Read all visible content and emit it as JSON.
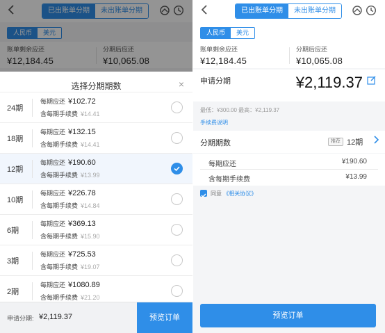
{
  "colors": {
    "accent": "#2f8ee8",
    "overlay": "rgba(0,0,0,0.42)",
    "muted": "#aaaaaa"
  },
  "tabs": [
    {
      "label": "已出账单分期",
      "active": true
    },
    {
      "label": "未出账单分期",
      "active": false
    }
  ],
  "header_icons": [
    "refresh-icon",
    "clock-icon"
  ],
  "currency": [
    {
      "label": "人民币",
      "active": true
    },
    {
      "label": "美元",
      "active": false
    }
  ],
  "balance": {
    "remaining_label": "账单剩余应还",
    "remaining_value": "¥12,184.45",
    "after_label": "分期后应还",
    "after_value": "¥10,065.08"
  },
  "sheet": {
    "title": "选择分期期数",
    "close_symbol": "×",
    "per_period_label": "每期应还",
    "fee_label": "含每期手续费",
    "options": [
      {
        "term": "24期",
        "amount": "¥102.72",
        "fee": "¥14.41",
        "selected": false
      },
      {
        "term": "18期",
        "amount": "¥132.15",
        "fee": "¥14.41",
        "selected": false
      },
      {
        "term": "12期",
        "amount": "¥190.60",
        "fee": "¥13.99",
        "selected": true
      },
      {
        "term": "10期",
        "amount": "¥226.78",
        "fee": "¥14.84",
        "selected": false
      },
      {
        "term": "6期",
        "amount": "¥369.13",
        "fee": "¥15.90",
        "selected": false
      },
      {
        "term": "3期",
        "amount": "¥725.53",
        "fee": "¥19.07",
        "selected": false
      },
      {
        "term": "2期",
        "amount": "¥1080.89",
        "fee": "¥21.20",
        "selected": false
      }
    ],
    "footer_label": "申请分期:",
    "footer_amount": "¥2,119.37",
    "preview_button": "预览订单"
  },
  "detail": {
    "apply_label": "申请分期",
    "apply_amount": "¥2,119.37",
    "limits": "最低：¥300.00  最高：¥2,119.37",
    "fee_link": "手续费说明",
    "term_label": "分期期数",
    "recommend_badge": "推荐",
    "term_value": "12期",
    "per_period_label": "每期应还",
    "per_period_value": "¥190.60",
    "fee_label": "含每期手续费",
    "fee_value": "¥13.99",
    "agree_text": "同意",
    "agree_link": "《相关协议》",
    "preview_button": "预览订单"
  }
}
